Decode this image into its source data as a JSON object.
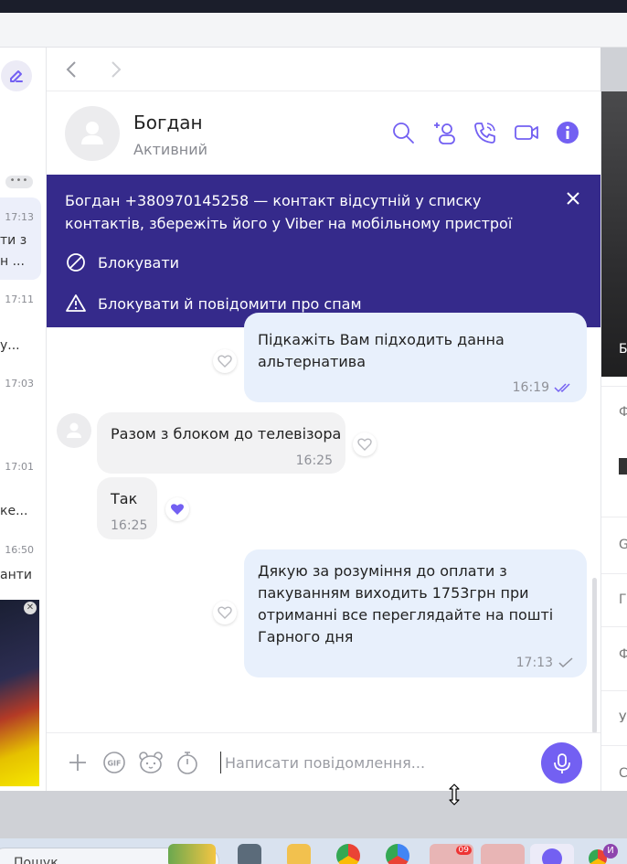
{
  "contact": {
    "name": "Богдан",
    "status": "Активний"
  },
  "banner": {
    "text": "Богдан +380970145258 — контакт відсутній у списку контактів, збережіть його у Viber на мобільному пристрої",
    "block_label": "Блокувати",
    "block_report_label": "Блокувати й повідомити про спам"
  },
  "messages": [
    {
      "direction": "out",
      "text_lines": [
        "Підкажіть Вам підходить данна",
        "альтернатива"
      ],
      "time": "16:19",
      "status": "read"
    },
    {
      "direction": "in",
      "text_lines": [
        "Разом з блоком до телевізора"
      ],
      "time": "16:25"
    },
    {
      "direction": "in",
      "text_lines": [
        "Так"
      ],
      "time": "16:25",
      "liked": true
    },
    {
      "direction": "out",
      "text_lines": [
        "Дякую за розуміння до оплати з",
        "пакуванням виходить 1753грн при",
        "отриманні все переглядайте на пошті",
        "Гарного дня"
      ],
      "time": "17:13",
      "status": "delivered"
    }
  ],
  "composer": {
    "placeholder": "Написати повідомлення..."
  },
  "left_list": {
    "items": [
      {
        "time": "17:13",
        "snippet_1": "ти з",
        "snippet_2": "н ..."
      },
      {
        "time": "17:11",
        "snippet_1": "у..."
      },
      {
        "time": "17:03"
      },
      {
        "time": "17:01",
        "snippet_1": "ке..."
      },
      {
        "time": "16:50",
        "snippet_1": "анти"
      }
    ]
  },
  "right_panel": {
    "image_label": "Б",
    "rows": [
      "Ф",
      "G",
      "Г",
      "Ф",
      "У",
      "С"
    ]
  },
  "taskbar": {
    "search_text": "Пошук",
    "badge": "09",
    "user_initial": "И"
  },
  "colors": {
    "brand": "#7360f2",
    "banner": "#352a8b",
    "outgoing_bubble": "#e8f0fc",
    "incoming_bubble": "#f2f2f3"
  }
}
